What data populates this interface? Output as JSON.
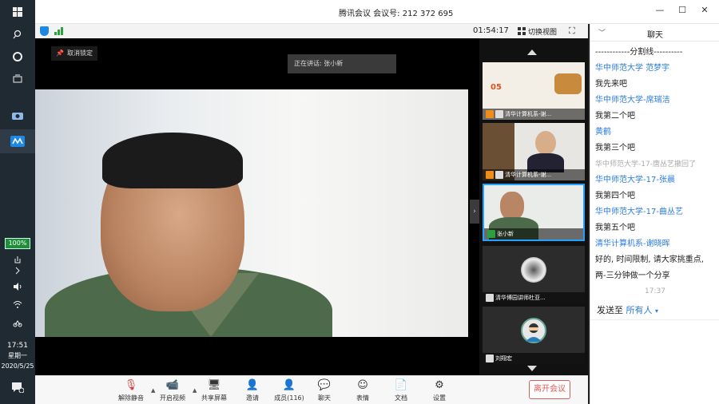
{
  "window": {
    "title": "腾讯会议 会议号: 212 372 695"
  },
  "taskbar": {
    "battery": "100%",
    "time": "17:51",
    "day": "星期一",
    "date": "2020/5/25"
  },
  "meeting": {
    "duration": "01:54:17",
    "view_switch_label": "切换视图",
    "unlock_label": "取消锁定",
    "speaking_label": "正在讲话: 张小新",
    "participants": [
      {
        "name": "清华计算机系-谢..."
      },
      {
        "name": "清华计算机系-谢..."
      },
      {
        "name": "张小新"
      },
      {
        "name": "清华博园讲师杜亚..."
      },
      {
        "name": "刘翔宏"
      }
    ],
    "slide_title": "05"
  },
  "toolbar": {
    "mute_label": "解除静音",
    "video_label": "开启视频",
    "share_label": "共享屏幕",
    "invite_label": "邀请",
    "members_label": "成员(116)",
    "chat_label": "聊天",
    "emoji_label": "表情",
    "docs_label": "文档",
    "settings_label": "设置",
    "leave_label": "离开会议"
  },
  "chat": {
    "title": "聊天",
    "divider": "------------分割线----------",
    "messages": [
      {
        "sender": "华中师范大学 范梦宇",
        "text": "我先来吧"
      },
      {
        "sender": "华中师范大学-席瑞洁",
        "text": "我第二个吧"
      },
      {
        "sender": "黄鹤",
        "text": "我第三个吧"
      },
      {
        "system": "华中师范大学-17-唐丛艺撤回了"
      },
      {
        "sender": "华中师范大学-17-张晨",
        "text": "我第四个吧"
      },
      {
        "sender": "华中师范大学-17-曲丛艺",
        "text": "我第五个吧"
      },
      {
        "sender": "清华计算机系-谢晓晖",
        "text": "好的, 时间限制, 请大家挑重点,",
        "text2": "两-三分钟做一个分享"
      }
    ],
    "time": "17:37",
    "send_to_label": "发送至",
    "send_to_target": "所有人"
  },
  "colors": {
    "accent": "#2a7be4",
    "leave": "#e05a5a",
    "active_tile": "#24a0ff"
  }
}
